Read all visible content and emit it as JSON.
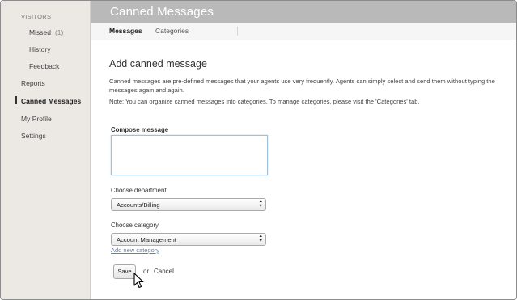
{
  "sidebar": {
    "heading": "VISITORS",
    "items": [
      {
        "label": "Missed",
        "count": "(1)"
      },
      {
        "label": "History"
      },
      {
        "label": "Feedback"
      },
      {
        "label": "Reports"
      },
      {
        "label": "Canned Messages"
      },
      {
        "label": "My Profile"
      },
      {
        "label": "Settings"
      }
    ],
    "active_item": "Canned Messages"
  },
  "header": {
    "title": "Canned Messages"
  },
  "tabs": [
    {
      "label": "Messages",
      "active": true
    },
    {
      "label": "Categories",
      "active": false
    }
  ],
  "main": {
    "title": "Add canned message",
    "description_1": "Canned messages are pre-defined messages that your agents use very frequently. Agents can simply select and send them without typing the messages again and again.",
    "description_2": "Note: You can organize canned messages into categories. To manage categories, please visit the 'Categories' tab.",
    "compose_label": "Compose message",
    "compose_value": "",
    "department_label": "Choose department",
    "department_selected": "Accounts/Billing",
    "category_label": "Choose category",
    "category_selected": "Account Management",
    "add_category_link": "Add new category",
    "save_label": "Save",
    "or_text": "or",
    "cancel_label": "Cancel"
  },
  "colors": {
    "header_bg": "#b9b9b9",
    "sidebar_bg": "#ece9e4",
    "link": "#6a7fa6",
    "compose_border": "#9fc0d8"
  }
}
